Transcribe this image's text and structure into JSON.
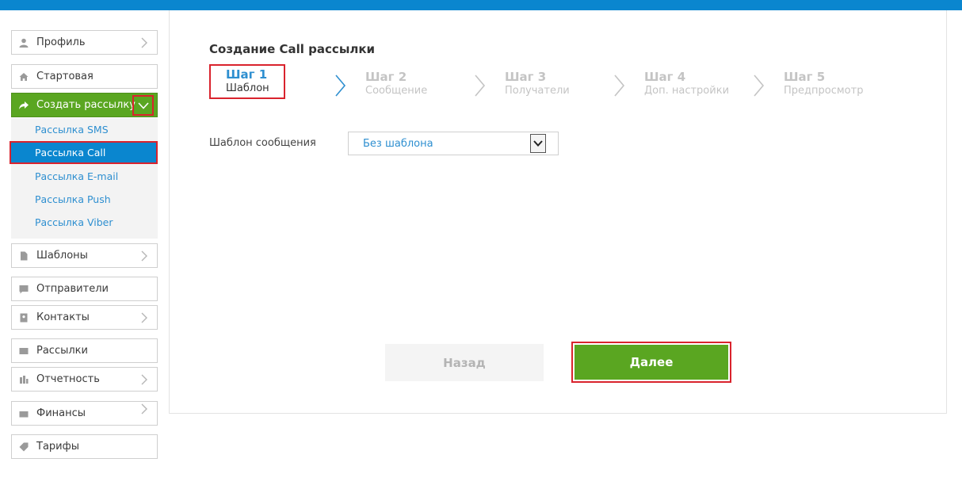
{
  "sidebar": {
    "items": [
      {
        "label": "Профиль",
        "icon": "user-icon",
        "has_chevron": true
      },
      {
        "label": "Стартовая",
        "icon": "home-icon",
        "has_chevron": false
      },
      {
        "label": "Создать рассылку",
        "icon": "share-icon",
        "active": true
      },
      {
        "label": "Шаблоны",
        "icon": "file-icon",
        "has_chevron": true
      },
      {
        "label": "Отправители",
        "icon": "sender-icon",
        "has_chevron": false
      },
      {
        "label": "Контакты",
        "icon": "contacts-icon",
        "has_chevron": true
      },
      {
        "label": "Рассылки",
        "icon": "envelope-icon",
        "has_chevron": false
      },
      {
        "label": "Отчетность",
        "icon": "report-icon",
        "has_chevron": true
      },
      {
        "label": "Финансы",
        "icon": "wallet-icon",
        "has_chevron": true
      },
      {
        "label": "Тарифы",
        "icon": "tag-icon",
        "has_chevron": false
      }
    ],
    "submenu": [
      {
        "label": "Рассылка SMS"
      },
      {
        "label": "Рассылка Call",
        "selected": true
      },
      {
        "label": "Рассылка E-mail"
      },
      {
        "label": "Рассылка Push"
      },
      {
        "label": "Рассылка Viber"
      }
    ]
  },
  "main": {
    "title": "Создание Call рассылки",
    "steps": [
      {
        "title": "Шаг 1",
        "subtitle": "Шаблон",
        "current": true
      },
      {
        "title": "Шаг 2",
        "subtitle": "Сообщение"
      },
      {
        "title": "Шаг 3",
        "subtitle": "Получатели"
      },
      {
        "title": "Шаг 4",
        "subtitle": "Доп. настройки"
      },
      {
        "title": "Шаг 5",
        "subtitle": "Предпросмотр"
      }
    ],
    "template_field": {
      "label": "Шаблон сообщения",
      "value": "Без шаблона"
    },
    "back_label": "Назад",
    "next_label": "Далее"
  },
  "colors": {
    "topbar": "#0a86cf",
    "accent_green": "#5aa621",
    "link_blue": "#2e8fd0",
    "highlight_red": "#d9232d"
  }
}
